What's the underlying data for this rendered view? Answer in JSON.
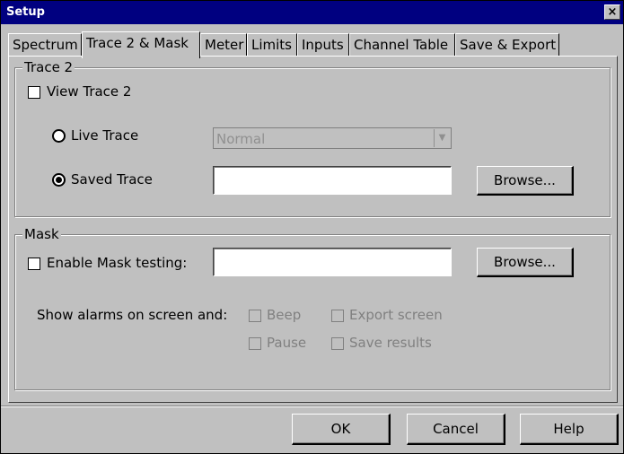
{
  "window": {
    "title": "Setup",
    "close_glyph": "×"
  },
  "tabs": [
    {
      "label": "Spectrum"
    },
    {
      "label": "Trace 2 & Mask"
    },
    {
      "label": "Meter"
    },
    {
      "label": "Limits"
    },
    {
      "label": "Inputs"
    },
    {
      "label": "Channel Table"
    },
    {
      "label": "Save & Export"
    }
  ],
  "trace2": {
    "group_label": "Trace 2",
    "view_label": "View Trace 2",
    "view_checked": false,
    "live_label": "Live Trace",
    "live_selected": false,
    "live_mode_value": "Normal",
    "saved_label": "Saved Trace",
    "saved_selected": true,
    "saved_path": "",
    "browse_label": "Browse..."
  },
  "mask": {
    "group_label": "Mask",
    "enable_label": "Enable Mask testing:",
    "enable_checked": false,
    "mask_path": "",
    "browse_label": "Browse...",
    "alarms_label": "Show alarms on screen and:",
    "beep_label": "Beep",
    "export_label": "Export screen",
    "pause_label": "Pause",
    "save_label": "Save results"
  },
  "footer": {
    "ok_label": "OK",
    "cancel_label": "Cancel",
    "help_label": "Help"
  }
}
